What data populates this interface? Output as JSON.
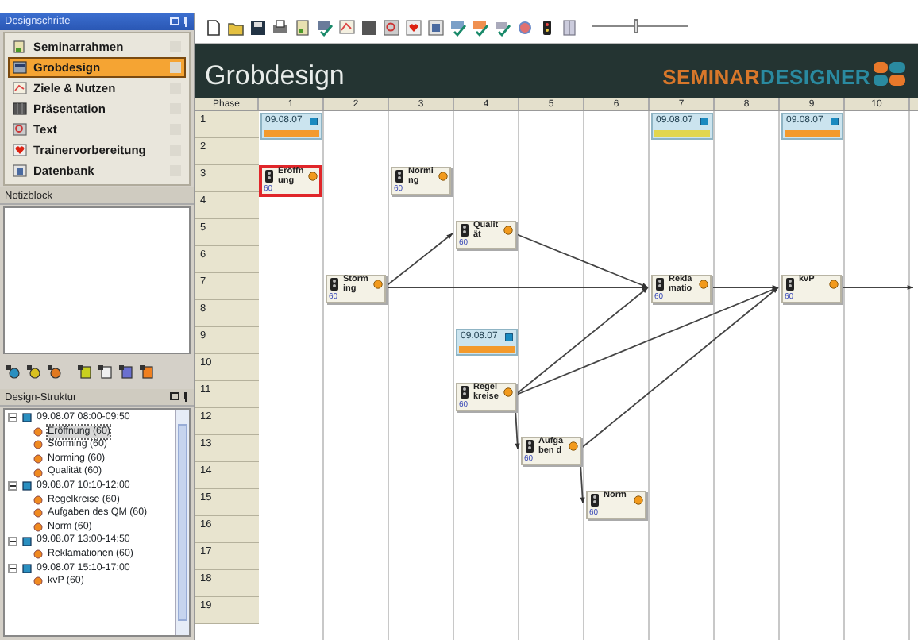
{
  "sidebar": {
    "title": "Designschritte",
    "items": [
      {
        "label": "Seminarrahmen",
        "selected": false
      },
      {
        "label": "Grobdesign",
        "selected": true
      },
      {
        "label": "Ziele & Nutzen",
        "selected": false
      },
      {
        "label": "Präsentation",
        "selected": false
      },
      {
        "label": "Text",
        "selected": false
      },
      {
        "label": "Trainervorbereitung",
        "selected": false
      },
      {
        "label": "Datenbank",
        "selected": false
      }
    ]
  },
  "notes": {
    "title": "Notizblock"
  },
  "structure": {
    "title": "Design-Struktur",
    "groups": [
      {
        "label": "09.08.07 08:00-09:50",
        "expanded": true,
        "children": [
          {
            "label": "Eröffnung (60)",
            "selected": true
          },
          {
            "label": "Storming (60)",
            "selected": false
          },
          {
            "label": "Norming (60)",
            "selected": false
          },
          {
            "label": "Qualität (60)",
            "selected": false
          }
        ]
      },
      {
        "label": "09.08.07 10:10-12:00",
        "expanded": true,
        "children": [
          {
            "label": "Regelkreise (60)",
            "selected": false
          },
          {
            "label": "Aufgaben des QM (60)",
            "selected": false
          },
          {
            "label": "Norm (60)",
            "selected": false
          }
        ]
      },
      {
        "label": "09.08.07 13:00-14:50",
        "expanded": true,
        "children": [
          {
            "label": "Reklamationen (60)",
            "selected": false
          }
        ]
      },
      {
        "label": "09.08.07 15:10-17:00",
        "expanded": true,
        "children": [
          {
            "label": "kvP (60)",
            "selected": false
          }
        ]
      }
    ]
  },
  "toolbar": {
    "zoom_slider": {
      "level": 0.45
    }
  },
  "header": {
    "title": "Grobdesign",
    "logo": [
      "SEMINAR",
      "DESIGNER"
    ]
  },
  "grid": {
    "corner": "Phase",
    "columns": [
      "1",
      "2",
      "3",
      "4",
      "5",
      "6",
      "7",
      "8",
      "9",
      "10"
    ],
    "rows": [
      "1",
      "2",
      "3",
      "4",
      "5",
      "6",
      "7",
      "8",
      "9",
      "10",
      "11",
      "12",
      "13",
      "14",
      "15",
      "16",
      "17",
      "18",
      "19"
    ],
    "sessions": [
      {
        "date": "09.08.07",
        "color": "#f39a2c"
      },
      {
        "date": "09.08.07",
        "color": "#e2d64e"
      },
      {
        "date": "09.08.07",
        "color": "#f39a2c"
      },
      {
        "date": "09.08.07",
        "color": "#f39a2c"
      }
    ],
    "modules": [
      {
        "lines": [
          "Eröffn",
          "ung"
        ],
        "duration": "60",
        "selected": true
      },
      {
        "lines": [
          "Normi",
          "ng"
        ],
        "duration": "60",
        "selected": false
      },
      {
        "lines": [
          "Qualit",
          "ät"
        ],
        "duration": "60",
        "selected": false
      },
      {
        "lines": [
          "Storm",
          "ing"
        ],
        "duration": "60",
        "selected": false
      },
      {
        "lines": [
          "Rekla",
          "matio"
        ],
        "duration": "60",
        "selected": false
      },
      {
        "lines": [
          "kvP"
        ],
        "duration": "60",
        "selected": false
      },
      {
        "lines": [
          "Regel",
          "kreise"
        ],
        "duration": "60",
        "selected": false
      },
      {
        "lines": [
          "Aufga",
          "ben d"
        ],
        "duration": "60",
        "selected": false
      },
      {
        "lines": [
          "Norm"
        ],
        "duration": "60",
        "selected": false
      }
    ]
  }
}
